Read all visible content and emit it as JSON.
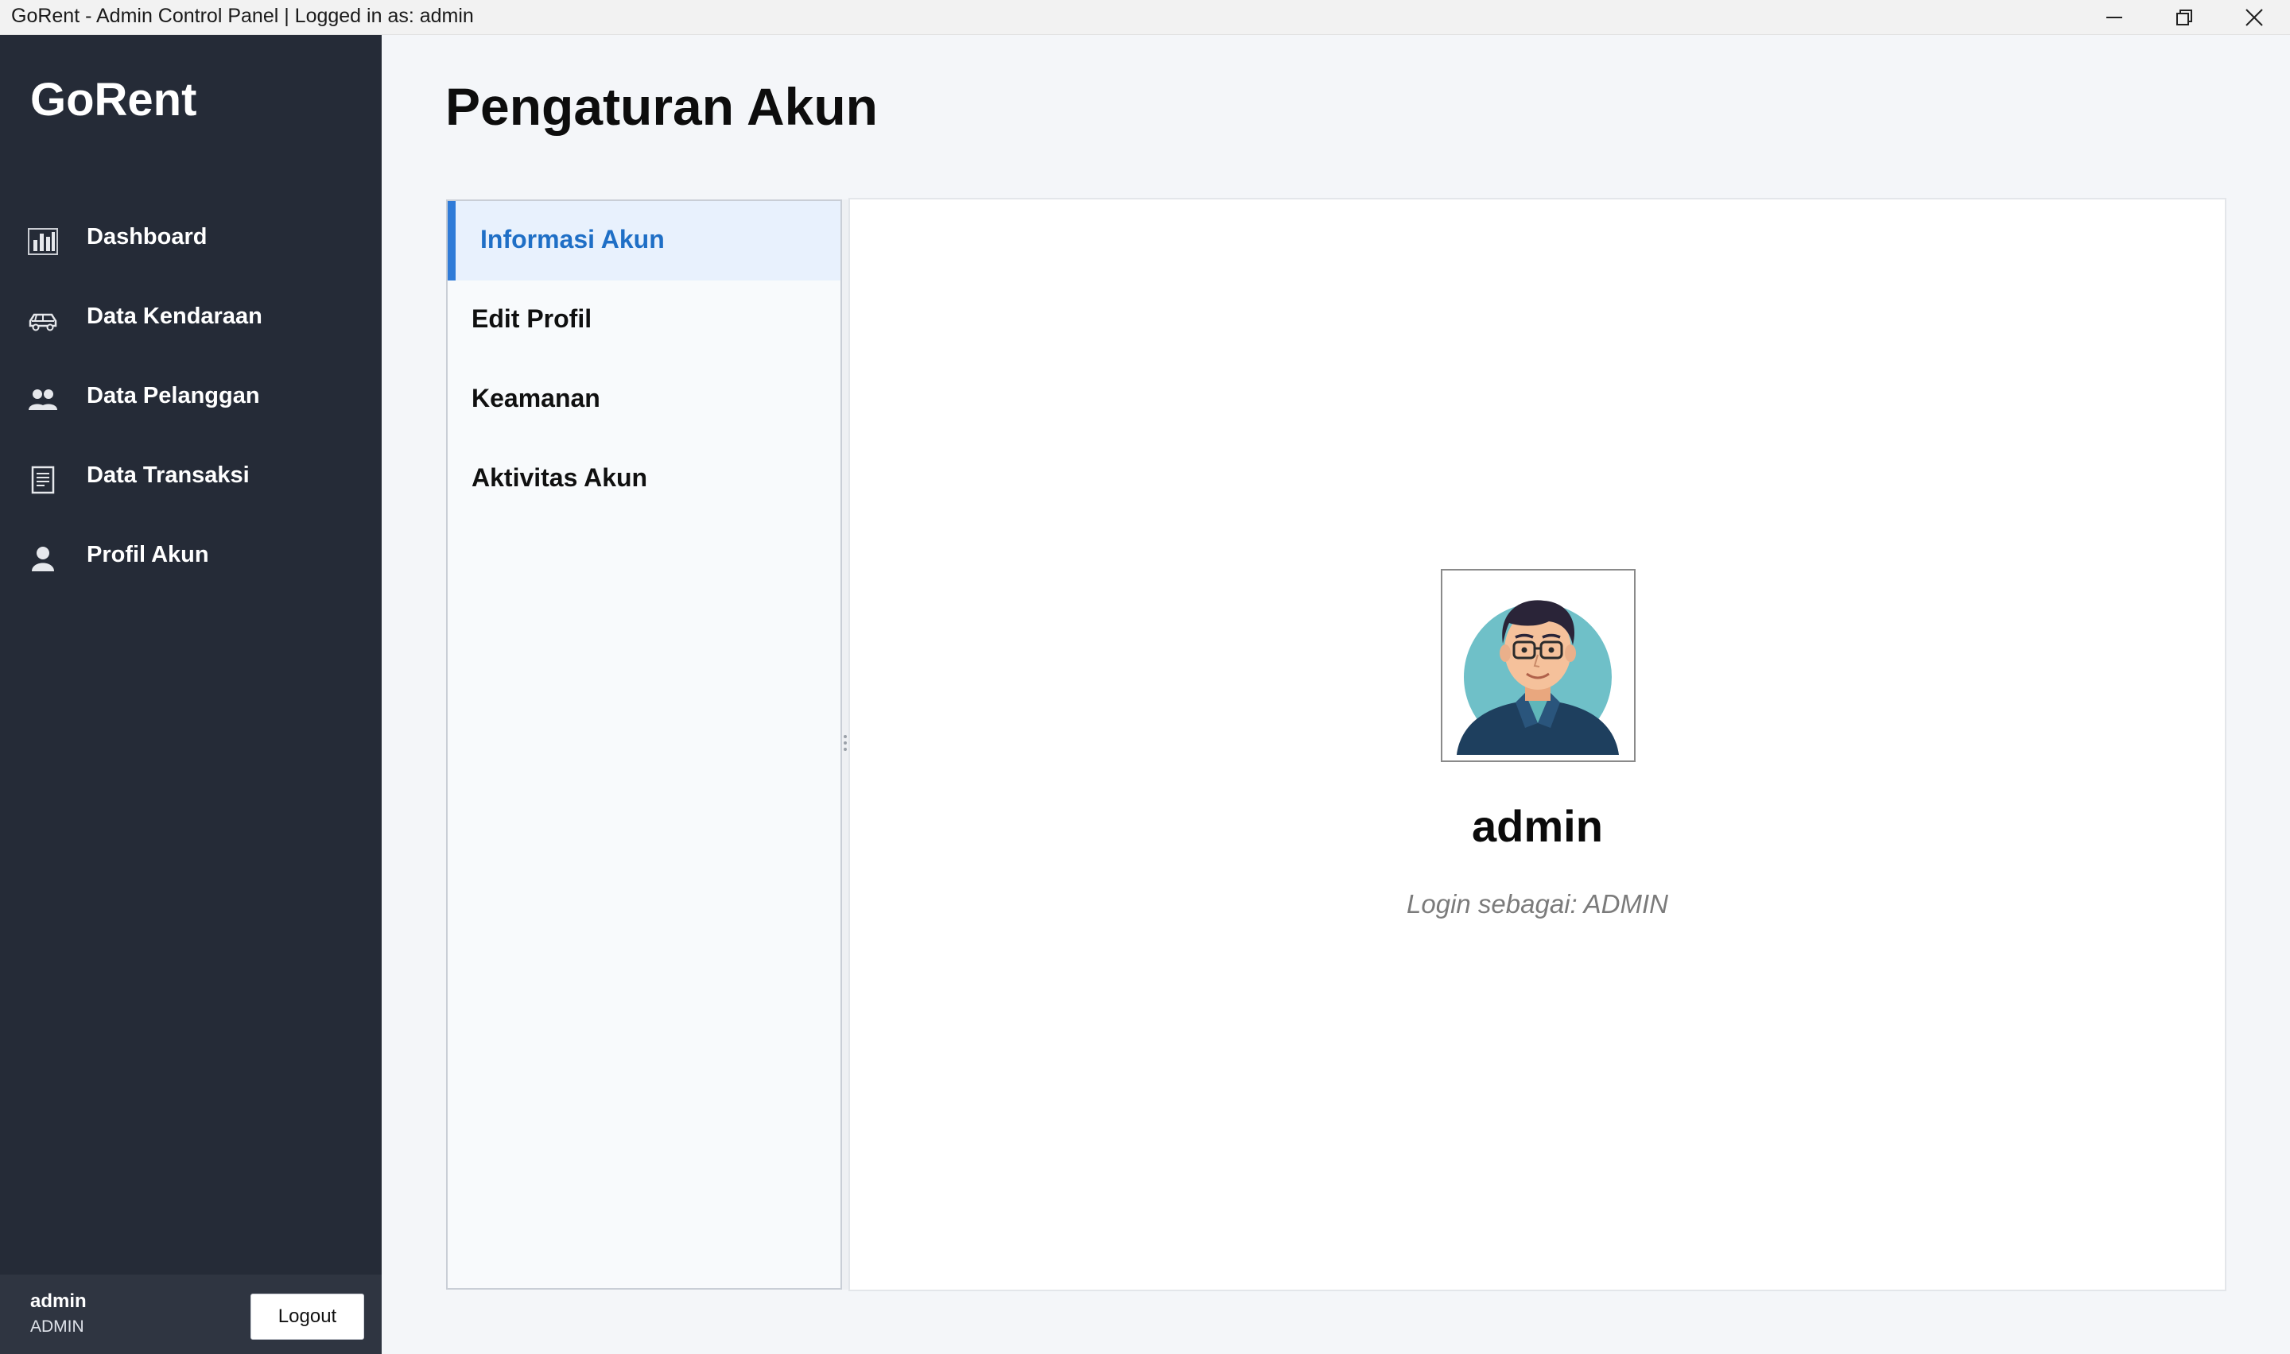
{
  "window": {
    "title": "GoRent - Admin Control Panel | Logged in as: admin"
  },
  "sidebar": {
    "brand": "GoRent",
    "items": [
      {
        "label": "Dashboard",
        "icon": "bar-chart-icon"
      },
      {
        "label": "Data Kendaraan",
        "icon": "car-icon"
      },
      {
        "label": "Data Pelanggan",
        "icon": "users-icon"
      },
      {
        "label": "Data Transaksi",
        "icon": "receipt-icon"
      },
      {
        "label": "Profil Akun",
        "icon": "user-icon"
      }
    ],
    "footer": {
      "username": "admin",
      "role": "ADMIN",
      "logout_label": "Logout"
    }
  },
  "main": {
    "title": "Pengaturan Akun",
    "tabs": [
      {
        "label": "Informasi Akun",
        "active": true
      },
      {
        "label": "Edit Profil",
        "active": false
      },
      {
        "label": "Keamanan",
        "active": false
      },
      {
        "label": "Aktivitas Akun",
        "active": false
      }
    ],
    "profile": {
      "name": "admin",
      "role_text": "Login sebagai: ADMIN"
    }
  },
  "colors": {
    "sidebar_bg": "#252b37",
    "accent": "#2f7bd8",
    "active_tab_bg": "#e8f1fd",
    "page_bg": "#f4f6f9"
  }
}
